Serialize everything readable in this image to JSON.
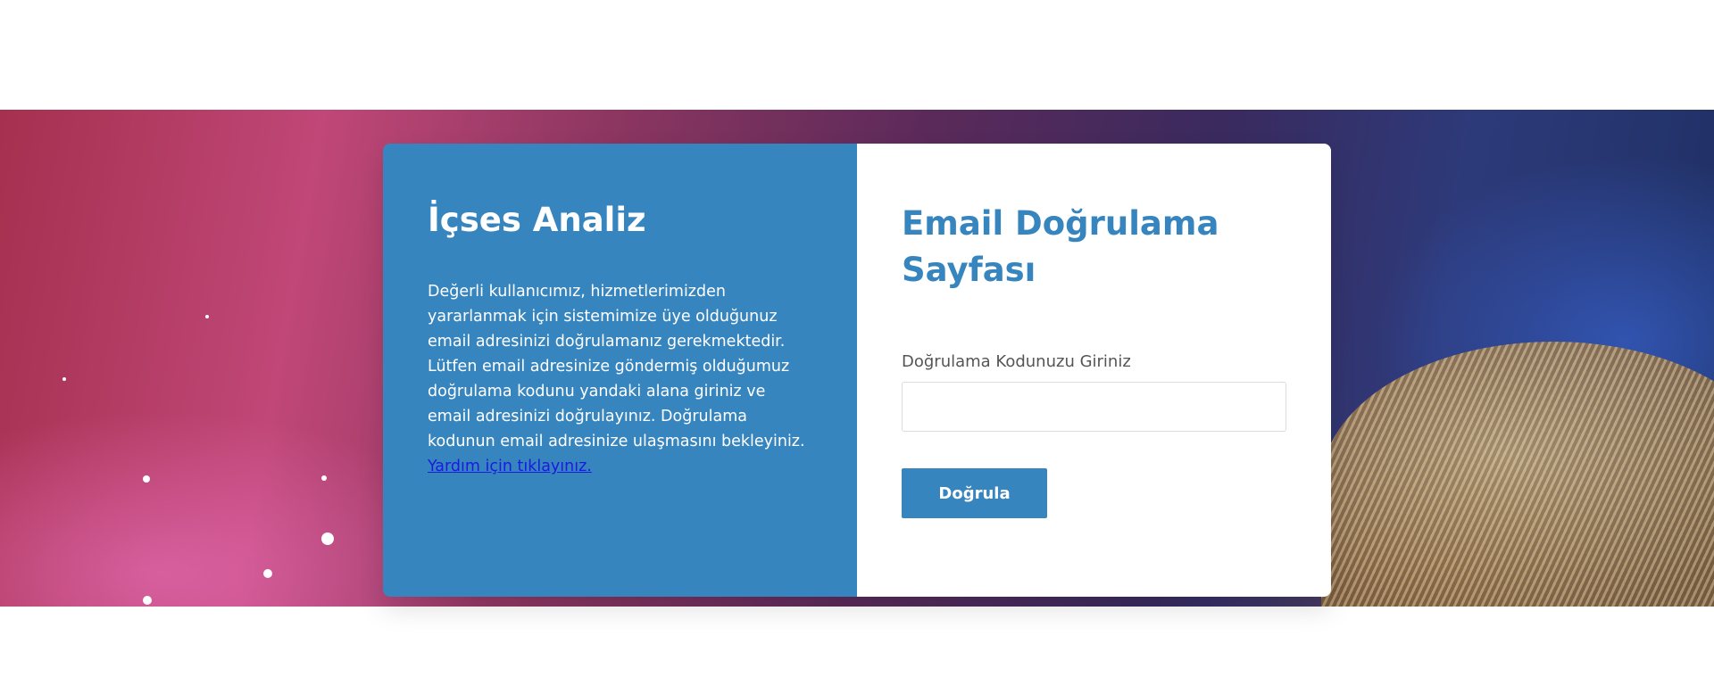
{
  "brand": {
    "title": "İçses Analiz"
  },
  "info": {
    "text": "Değerli kullanıcımız, hizmetlerimizden yararlanmak için sistemimize üye olduğunuz email adresinizi doğrulamanız gerekmektedir. Lütfen email adresinize göndermiş olduğumuz doğrulama kodunu yandaki alana giriniz ve email adresinizi doğrulayınız. Doğrulama kodunun email adresinize ulaşmasını bekleyiniz. ",
    "help_link": "Yardım için tıklayınız."
  },
  "form": {
    "title_line1": "Email Doğrulama",
    "title_line2": "Sayfası",
    "code_label": "Doğrulama Kodunuzu Giriniz",
    "code_value": "",
    "submit_label": "Doğrula"
  },
  "colors": {
    "primary": "#3785be",
    "link": "#1a1ae0"
  }
}
